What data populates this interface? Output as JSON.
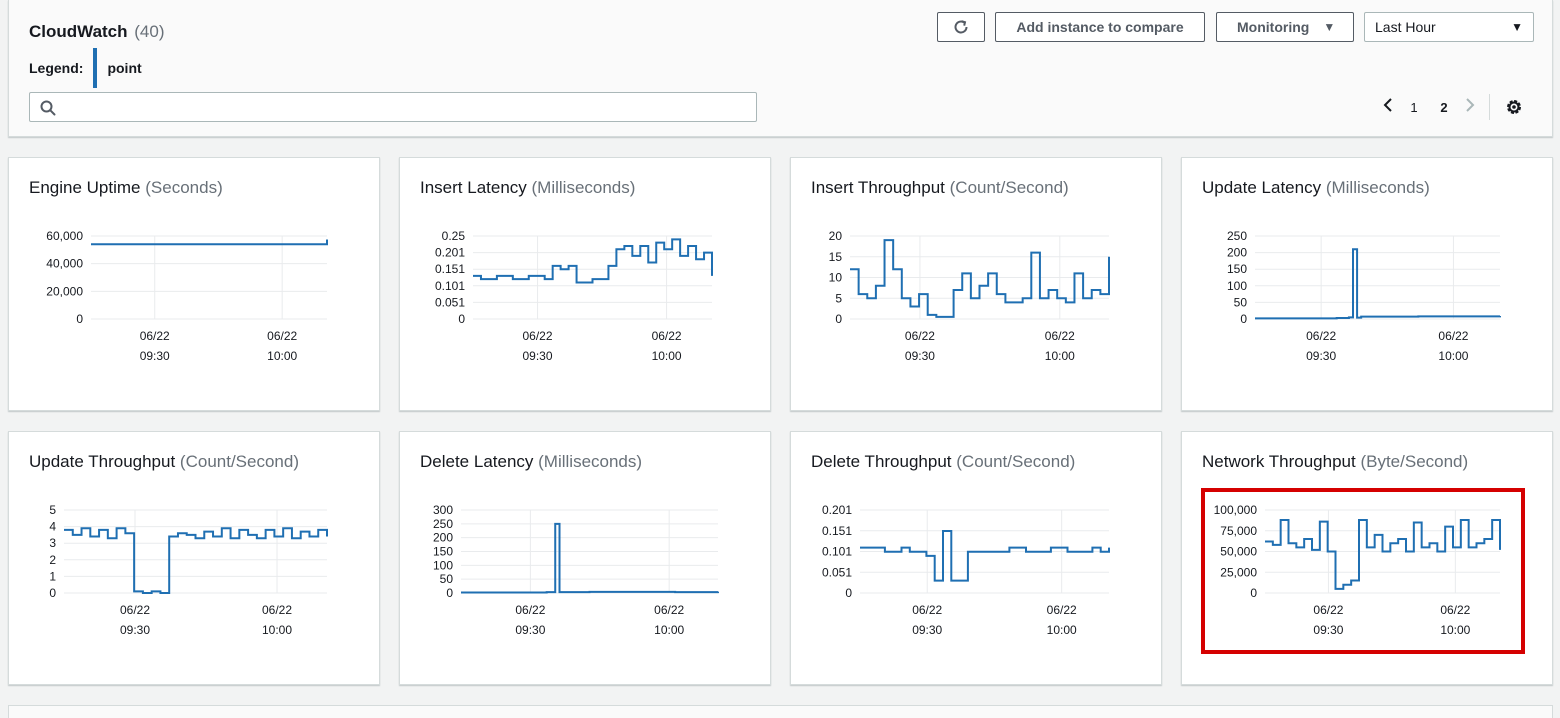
{
  "header": {
    "title": "CloudWatch",
    "count": "(40)",
    "legend_label": "Legend:",
    "legend_value": "point",
    "legend_color": "#1f6fb2",
    "search_placeholder": "",
    "refresh_icon": "refresh-icon",
    "add_compare_label": "Add instance to compare",
    "monitoring_label": "Monitoring",
    "time_range": "Last Hour",
    "pages": [
      "1",
      "2"
    ],
    "current_page": "2",
    "settings_icon": "gear-icon"
  },
  "colors": {
    "line": "#1f6fb2",
    "grid": "#e9ebed",
    "highlight": "#d50000"
  },
  "cards": [
    {
      "title": "Engine Uptime",
      "unit": "(Seconds)"
    },
    {
      "title": "Insert Latency",
      "unit": "(Milliseconds)"
    },
    {
      "title": "Insert Throughput",
      "unit": "(Count/Second)"
    },
    {
      "title": "Update Latency",
      "unit": "(Milliseconds)"
    },
    {
      "title": "Update Throughput",
      "unit": "(Count/Second)"
    },
    {
      "title": "Delete Latency",
      "unit": "(Milliseconds)"
    },
    {
      "title": "Delete Throughput",
      "unit": "(Count/Second)"
    },
    {
      "title": "Network Throughput",
      "unit": "(Byte/Second)",
      "highlighted": true
    }
  ],
  "chart_data": [
    {
      "type": "line",
      "title": "Engine Uptime (Seconds)",
      "x_ticks": [
        "06/22 09:30",
        "06/22 10:00"
      ],
      "y_ticks": [
        "60,000",
        "40,000",
        "20,000",
        "0"
      ],
      "ylim": [
        0,
        60000
      ],
      "xlim": [
        0,
        60
      ],
      "grid": true,
      "series": [
        {
          "x": [
            0,
            60
          ],
          "y": [
            54000,
            57500
          ]
        }
      ]
    },
    {
      "type": "line",
      "title": "Insert Latency (Milliseconds)",
      "x_ticks": [
        "06/22 09:30",
        "06/22 10:00"
      ],
      "y_ticks": [
        "0.25",
        "0.201",
        "0.151",
        "0.101",
        "0.051",
        "0"
      ],
      "ylim": [
        0,
        0.25
      ],
      "xlim": [
        0,
        60
      ],
      "grid": true,
      "series": [
        {
          "x": [
            0,
            2,
            4,
            6,
            8,
            10,
            12,
            14,
            16,
            18,
            20,
            22,
            24,
            26,
            28,
            30,
            32,
            34,
            36,
            38,
            40,
            42,
            44,
            46,
            48,
            50,
            52,
            54,
            56,
            58,
            60
          ],
          "y": [
            0.13,
            0.12,
            0.12,
            0.13,
            0.13,
            0.12,
            0.12,
            0.13,
            0.13,
            0.12,
            0.16,
            0.15,
            0.16,
            0.11,
            0.11,
            0.12,
            0.12,
            0.16,
            0.21,
            0.22,
            0.19,
            0.22,
            0.17,
            0.23,
            0.21,
            0.24,
            0.19,
            0.22,
            0.18,
            0.2,
            0.13
          ]
        }
      ]
    },
    {
      "type": "line",
      "title": "Insert Throughput (Count/Second)",
      "x_ticks": [
        "06/22 09:30",
        "06/22 10:00"
      ],
      "y_ticks": [
        "20",
        "15",
        "10",
        "5",
        "0"
      ],
      "ylim": [
        0,
        20
      ],
      "xlim": [
        0,
        60
      ],
      "grid": true,
      "series": [
        {
          "x": [
            0,
            2,
            4,
            6,
            8,
            10,
            12,
            14,
            16,
            18,
            20,
            22,
            24,
            26,
            28,
            30,
            32,
            34,
            36,
            38,
            40,
            42,
            44,
            46,
            48,
            50,
            52,
            54,
            56,
            58,
            60
          ],
          "y": [
            12,
            6,
            5,
            8,
            19,
            12,
            5,
            3,
            6,
            1,
            0.5,
            0.5,
            7,
            11,
            5,
            8,
            11,
            6,
            4,
            4,
            5,
            16,
            5,
            7,
            5,
            4,
            11,
            5,
            7,
            6,
            15
          ]
        }
      ]
    },
    {
      "type": "line",
      "title": "Update Latency (Milliseconds)",
      "x_ticks": [
        "06/22 09:30",
        "06/22 10:00"
      ],
      "y_ticks": [
        "250",
        "200",
        "150",
        "100",
        "50",
        "0"
      ],
      "ylim": [
        0,
        250
      ],
      "xlim": [
        0,
        60
      ],
      "grid": true,
      "series": [
        {
          "x": [
            0,
            10,
            20,
            23,
            24,
            25,
            26,
            30,
            40,
            50,
            60
          ],
          "y": [
            2,
            2,
            3,
            5,
            210,
            4,
            7,
            7,
            8,
            8,
            9
          ]
        }
      ]
    },
    {
      "type": "line",
      "title": "Update Throughput (Count/Second)",
      "x_ticks": [
        "06/22 09:30",
        "06/22 10:00"
      ],
      "y_ticks": [
        "5",
        "4",
        "3",
        "2",
        "1",
        "0"
      ],
      "ylim": [
        0,
        5
      ],
      "xlim": [
        0,
        60
      ],
      "grid": true,
      "series": [
        {
          "x": [
            0,
            2,
            4,
            6,
            8,
            10,
            12,
            14,
            16,
            18,
            20,
            22,
            24,
            26,
            28,
            30,
            32,
            34,
            36,
            38,
            40,
            42,
            44,
            46,
            48,
            50,
            52,
            54,
            56,
            58,
            60
          ],
          "y": [
            3.8,
            3.5,
            3.9,
            3.4,
            3.8,
            3.3,
            3.9,
            3.6,
            0.1,
            0,
            0.1,
            0,
            3.4,
            3.6,
            3.5,
            3.3,
            3.7,
            3.4,
            3.9,
            3.3,
            3.8,
            3.5,
            3.3,
            3.8,
            3.4,
            3.9,
            3.3,
            3.7,
            3.4,
            3.8,
            3.4
          ]
        }
      ]
    },
    {
      "type": "line",
      "title": "Delete Latency (Milliseconds)",
      "x_ticks": [
        "06/22 09:30",
        "06/22 10:00"
      ],
      "y_ticks": [
        "300",
        "250",
        "200",
        "150",
        "100",
        "50",
        "0"
      ],
      "ylim": [
        0,
        300
      ],
      "xlim": [
        0,
        60
      ],
      "grid": true,
      "series": [
        {
          "x": [
            0,
            10,
            20,
            21,
            22,
            23,
            30,
            40,
            50,
            60
          ],
          "y": [
            2,
            2,
            3,
            3,
            250,
            3,
            4,
            4,
            3,
            5
          ]
        }
      ]
    },
    {
      "type": "line",
      "title": "Delete Throughput (Count/Second)",
      "x_ticks": [
        "06/22 09:30",
        "06/22 10:00"
      ],
      "y_ticks": [
        "0.201",
        "0.151",
        "0.101",
        "0.051",
        "0"
      ],
      "ylim": [
        0,
        0.201
      ],
      "xlim": [
        0,
        60
      ],
      "grid": true,
      "series": [
        {
          "x": [
            0,
            4,
            6,
            10,
            12,
            16,
            18,
            20,
            22,
            24,
            26,
            28,
            30,
            34,
            36,
            40,
            44,
            46,
            50,
            54,
            56,
            58,
            60
          ],
          "y": [
            0.11,
            0.11,
            0.1,
            0.11,
            0.1,
            0.09,
            0.03,
            0.15,
            0.03,
            0.03,
            0.1,
            0.1,
            0.1,
            0.1,
            0.11,
            0.1,
            0.1,
            0.11,
            0.1,
            0.1,
            0.11,
            0.1,
            0.11
          ]
        }
      ]
    },
    {
      "type": "line",
      "title": "Network Throughput (Byte/Second)",
      "x_ticks": [
        "06/22 09:30",
        "06/22 10:00"
      ],
      "y_ticks": [
        "100,000",
        "75,000",
        "50,000",
        "25,000",
        "0"
      ],
      "ylim": [
        0,
        100000
      ],
      "xlim": [
        0,
        60
      ],
      "grid": true,
      "series": [
        {
          "x": [
            0,
            2,
            4,
            6,
            8,
            10,
            12,
            14,
            16,
            18,
            20,
            22,
            24,
            26,
            28,
            30,
            32,
            34,
            36,
            38,
            40,
            42,
            44,
            46,
            48,
            50,
            52,
            54,
            56,
            58,
            60
          ],
          "y": [
            62000,
            58000,
            88000,
            60000,
            55000,
            65000,
            52000,
            86000,
            50000,
            5000,
            10000,
            15000,
            88000,
            55000,
            70000,
            50000,
            60000,
            65000,
            50000,
            85000,
            55000,
            60000,
            50000,
            80000,
            55000,
            88000,
            55000,
            60000,
            65000,
            88000,
            52000
          ]
        }
      ]
    }
  ]
}
